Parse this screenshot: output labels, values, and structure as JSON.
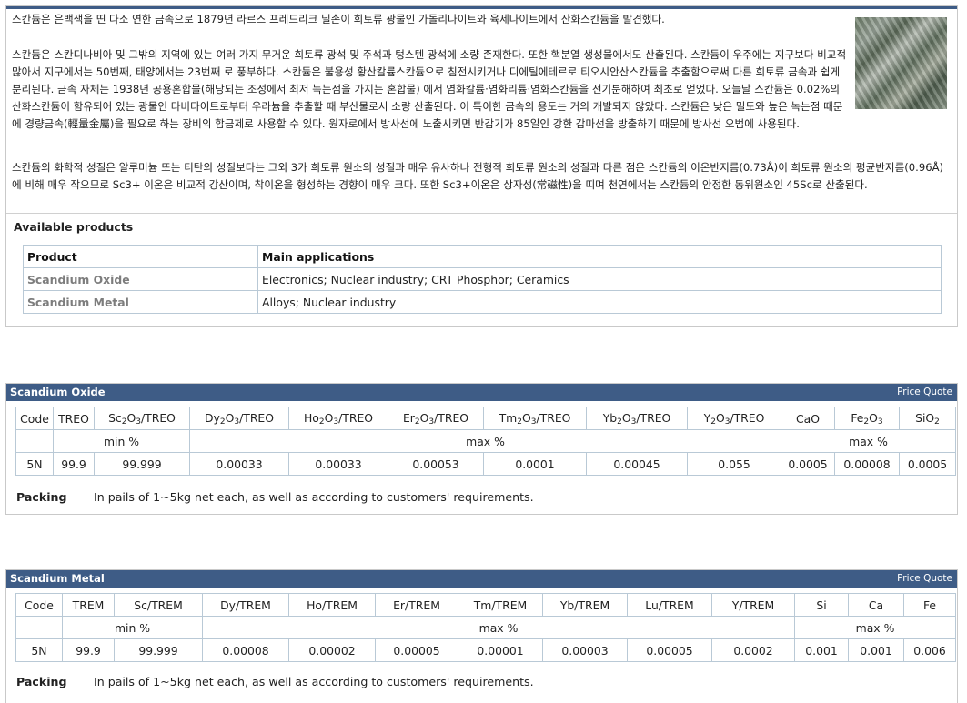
{
  "intro": {
    "p1": "스칸듐은 은백색을 띤 다소 연한 금속으로 1879년 라르스 프레드리크 닐손이 희토류 광물인 가돌리나이트와 육세나이트에서 산화스칸듐을 발견했다.",
    "p2": "스칸듐은 스칸디나비아 및 그밖의 지역에 있는 여러 가지 무거운 희토류 광석 및 주석과 텅스텐 광석에 소량 존재한다. 또한 핵분열 생성물에서도 산출된다. 스칸듐이 우주에는 지구보다 비교적 많아서 지구에서는 50번째, 태양에서는 23번째 로 풍부하다. 스칸듐은 불용성 황산칼륨스칸듐으로 침전시키거나 디에틸에테르로 티오시안산스칸듐을 추출함으로써 다른 희토류 금속과 쉽게 분리된다. 금속 자체는 1938년 공용혼합물(해당되는 조성에서 최저 녹는점을 가지는 혼합물) 에서 염화칼륨·염화리튬·염화스칸듐을 전기분해하여 최초로 얻었다. 오늘날 스칸듐은 0.02%의 산화스칸듐이 함유되어 있는 광물인 다비다이트로부터 우라늄을 추출할 때 부산물로서 소량 산출된다. 이 특이한 금속의 용도는 거의 개발되지 않았다. 스칸듐은 낮은 밀도와 높은 녹는점 때문에 경량금속(輕量金屬)을 필요로 하는 장비의 합금제로 사용할 수 있다. 원자로에서 방사선에 노출시키면 반감기가 85일인 강한 감마선을 방출하기 때문에 방사선 오법에 사용된다.",
    "p3": "스칸듐의 화학적 성질은 알루미늄 또는 티탄의 성질보다는 그외 3가 희토류 원소의 성질과 매우 유사하나 전형적 희토류 원소의 성질과 다른 점은 스칸듐의 이온반지름(0.73Å)이 희토류 원소의 평균반지름(0.96Å)에 비해 매우 작으므로 Sc3+ 이온은 비교적 강산이며, 착이온을 형성하는 경향이 매우 크다. 또한 Sc3+이온은 상자성(常磁性)을 띠며 천연에서는 스칸듐의 안정한 동위원소인 45Sc로 산출된다."
  },
  "available": {
    "title": "Available products",
    "head_product": "Product",
    "head_apps": "Main applications",
    "rows": [
      {
        "product": "Scandium Oxide",
        "apps": "Electronics; Nuclear industry; CRT Phosphor; Ceramics"
      },
      {
        "product": "Scandium Metal",
        "apps": "Alloys; Nuclear industry"
      }
    ]
  },
  "oxide": {
    "title": "Scandium Oxide",
    "price_quote": "Price Quote",
    "headers": [
      "Code",
      "TREO",
      "Sc2O3/TREO",
      "Dy2O3/TREO",
      "Ho2O3/TREO",
      "Er2O3/TREO",
      "Tm2O3/TREO",
      "Yb2O3/TREO",
      "Y2O3/TREO",
      "CaO",
      "Fe2O3",
      "SiO2"
    ],
    "groups": [
      "min %",
      "max %",
      "max %"
    ],
    "row": [
      "5N",
      "99.9",
      "99.999",
      "0.00033",
      "0.00033",
      "0.00053",
      "0.0001",
      "0.00045",
      "0.055",
      "0.0005",
      "0.00008",
      "0.0005"
    ],
    "packing_label": "Packing",
    "packing_text": "In pails of 1~5kg net each, as well as according to customers' requirements."
  },
  "metal": {
    "title": "Scandium Metal",
    "price_quote": "Price Quote",
    "headers": [
      "Code",
      "TREM",
      "Sc/TREM",
      "Dy/TREM",
      "Ho/TREM",
      "Er/TREM",
      "Tm/TREM",
      "Yb/TREM",
      "Lu/TREM",
      "Y/TREM",
      "Si",
      "Ca",
      "Fe"
    ],
    "groups": [
      "min %",
      "max %",
      "max %"
    ],
    "row": [
      "5N",
      "99.9",
      "99.999",
      "0.00008",
      "0.00002",
      "0.00005",
      "0.00001",
      "0.00003",
      "0.00005",
      "0.0002",
      "0.001",
      "0.001",
      "0.006"
    ],
    "packing_label": "Packing",
    "packing_text": "In pails of 1~5kg net each, as well as according to customers' requirements."
  },
  "colors": {
    "titlebar": "#3e5c86",
    "border": "#b9c9d6",
    "product_name": "#7d7d7d"
  }
}
